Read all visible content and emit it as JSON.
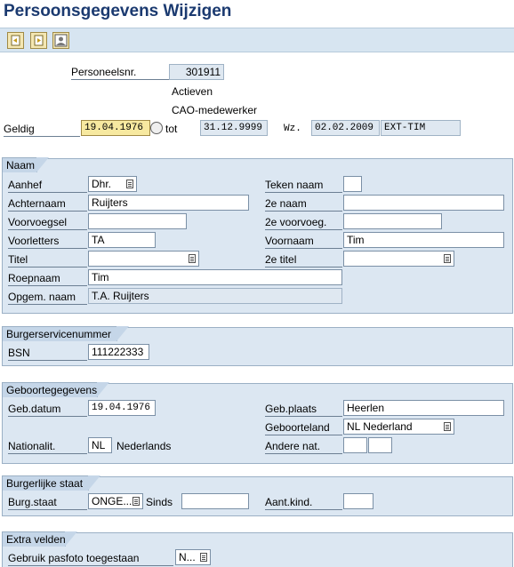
{
  "window": {
    "title": "Persoonsgegevens Wijzigen"
  },
  "toolbar": {
    "buttons": [
      "previous-record-icon",
      "next-record-icon",
      "photo-icon"
    ]
  },
  "header": {
    "personnel_label": "Personeelsnr.",
    "personnel_value": "301911",
    "status1": "Actieven",
    "status2": "CAO-medewerker",
    "valid_label": "Geldig",
    "valid_from": "19.04.1976",
    "to_label": "tot",
    "valid_to": "31.12.9999",
    "wz_label": "Wz.",
    "wz_date": "02.02.2009",
    "wz_user": "EXT-TIM"
  },
  "naam": {
    "title": "Naam",
    "aanhef_label": "Aanhef",
    "aanhef_value": "Dhr.",
    "teken_label": "Teken naam",
    "teken_value": "",
    "achternaam_label": "Achternaam",
    "achternaam_value": "Ruijters",
    "tweede_naam_label": "2e naam",
    "tweede_naam_value": "",
    "voorvoegsel_label": "Voorvoegsel",
    "voorvoegsel_value": "",
    "tweede_voorvoeg_label": "2e voorvoeg.",
    "tweede_voorvoeg_value": "",
    "voorletters_label": "Voorletters",
    "voorletters_value": "TA",
    "voornaam_label": "Voornaam",
    "voornaam_value": "Tim",
    "titel_label": "Titel",
    "titel_value": "",
    "tweede_titel_label": "2e titel",
    "tweede_titel_value": "",
    "roepnaam_label": "Roepnaam",
    "roepnaam_value": "Tim",
    "opgem_label": "Opgem. naam",
    "opgem_value": "T.A. Ruijters"
  },
  "bsn_group": {
    "title": "Burgerservicenummer",
    "bsn_label": "BSN",
    "bsn_value": "111222333"
  },
  "geboorte": {
    "title": "Geboortegegevens",
    "gebdatum_label": "Geb.datum",
    "gebdatum_value": "19.04.1976",
    "gebplaats_label": "Geb.plaats",
    "gebplaats_value": "Heerlen",
    "geboorteland_label": "Geboorteland",
    "geboorteland_value": "NL Nederland",
    "nationalit_label": "Nationalit.",
    "nationalit_code": "NL",
    "nationalit_text": "Nederlands",
    "andere_label": "Andere nat.",
    "andere_value1": "",
    "andere_value2": ""
  },
  "burgerlijk": {
    "title": "Burgerlijke staat",
    "burgstaat_label": "Burg.staat",
    "burgstaat_value": "ONGE...",
    "sinds_label": "Sinds",
    "sinds_value": "",
    "aantkind_label": "Aant.kind.",
    "aantkind_value": ""
  },
  "extra": {
    "title": "Extra velden",
    "pasfoto_label": "Gebruik pasfoto toegestaan",
    "pasfoto_value": "N..."
  }
}
